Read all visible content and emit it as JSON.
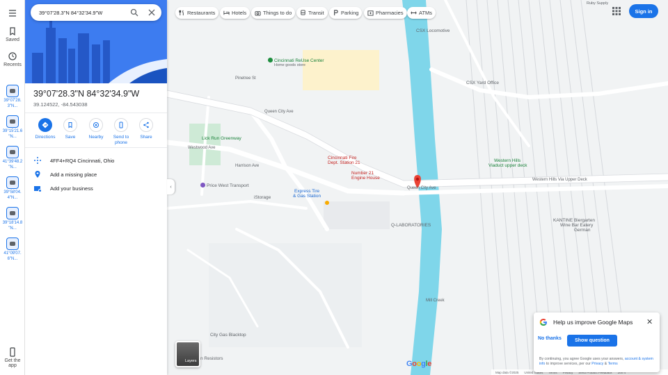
{
  "search": {
    "value": "39°07'28.3\"N 84°32'34.9\"W"
  },
  "rail": {
    "saved_label": "Saved",
    "recents_label": "Recents",
    "get_app_label": "Get the app",
    "recent_items": [
      {
        "line1": "39°07'28.",
        "line2": "3\"N..."
      },
      {
        "line1": "39°15'21.6",
        "line2": "\"N..."
      },
      {
        "line1": "41°39'48.2",
        "line2": "\"N..."
      },
      {
        "line1": "39°58'04.",
        "line2": "4\"N..."
      },
      {
        "line1": "39°18'14.8",
        "line2": "\"N..."
      },
      {
        "line1": "41°09'07.",
        "line2": "6\"N..."
      }
    ]
  },
  "place": {
    "title": "39°07'28.3\"N 84°32'34.9\"W",
    "coords": "39.124522, -84.543038"
  },
  "actions": [
    {
      "label": "Directions",
      "icon": "directions-icon"
    },
    {
      "label": "Save",
      "icon": "bookmark-icon"
    },
    {
      "label": "Nearby",
      "icon": "nearby-icon"
    },
    {
      "label": "Send to phone",
      "icon": "phone-icon"
    },
    {
      "label": "Share",
      "icon": "share-icon"
    }
  ],
  "info": {
    "plus_code": "4FF4+RQ4 Cincinnati, Ohio",
    "add_place": "Add a missing place",
    "add_business": "Add your business"
  },
  "chips": [
    {
      "label": "Restaurants",
      "icon": "fork-knife-icon"
    },
    {
      "label": "Hotels",
      "icon": "bed-icon"
    },
    {
      "label": "Things to do",
      "icon": "camera-icon"
    },
    {
      "label": "Transit",
      "icon": "train-icon"
    },
    {
      "label": "Parking",
      "icon": "parking-icon"
    },
    {
      "label": "Pharmacies",
      "icon": "pharmacy-icon"
    },
    {
      "label": "ATMs",
      "icon": "atm-icon"
    }
  ],
  "header": {
    "signin_label": "Sign in"
  },
  "map_labels": {
    "reuse_center": "Cincinnati ReUse Center",
    "reuse_sub": "Home goods store",
    "csx_locomotive": "CSX Locomotive",
    "csx_yard": "CSX Yard Office",
    "ruby_supply": "Ruby Supply",
    "fire_dept": "Cincinnati Fire",
    "fire_dept2": "Dept. Station 21",
    "engine_house": "Number 21",
    "engine_house2": "Engine House",
    "viaduct": "Western Hills",
    "viaduct2": "Viaduct upper deck",
    "lick_run": "Lick Run Greenway",
    "price_west": "Price West Transport",
    "express_tire": "Express Tire",
    "express_tire2": "& Gas Station",
    "istorage": "iStorage",
    "q_lab": "Q-LABORATORIES",
    "kantine": "KANTINE Biergarten",
    "kantine2": "Wine Bar Eatery",
    "kantine3": "German",
    "city_gas": "City Gas Blacktop",
    "resistors": "n Resistors",
    "queen_city": "Queen City Ave",
    "queen_city2": "Queen City Ave",
    "westwood": "Westwood Ave",
    "harrison": "Harrison Ave",
    "viaduct_road": "Western Hills Via Upper Deck",
    "pinetree": "Pinetree St",
    "mill_creek": "Mill Creek",
    "layers": "Layers",
    "logo": "Google"
  },
  "footer": {
    "map_data": "Map data ©2025",
    "country": "United States",
    "terms": "Terms",
    "privacy": "Privacy",
    "feedback": "Send Product Feedback",
    "scale": "200 ft"
  },
  "survey": {
    "title": "Help us improve Google Maps",
    "no_thanks": "No thanks",
    "show_question": "Show question",
    "legal_1": "By continuing, you agree Google uses your answers,",
    "legal_link1": "account & system info",
    "legal_2": "to improve services, per our",
    "legal_link2": "Privacy",
    "legal_amp": "&",
    "legal_link3": "Terms"
  },
  "colors": {
    "accent": "#1a73e8",
    "river": "#7fd6ea",
    "marker": "#ea4335",
    "park": "#c8e6c9"
  }
}
